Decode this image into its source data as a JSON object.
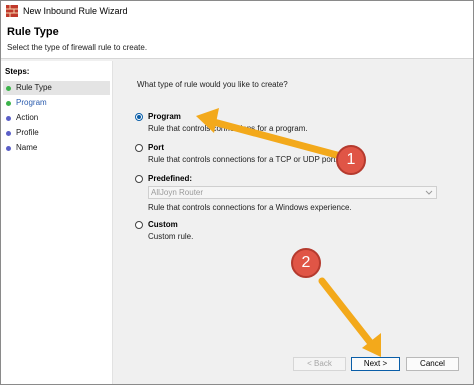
{
  "window": {
    "title": "New Inbound Rule Wizard"
  },
  "header": {
    "title": "Rule Type",
    "subtitle": "Select the type of firewall rule to create."
  },
  "steps": {
    "label": "Steps:",
    "items": [
      {
        "label": "Rule Type",
        "dot_color": "#3cb34a",
        "active": true
      },
      {
        "label": "Program",
        "dot_color": "#3cb34a",
        "active": false
      },
      {
        "label": "Action",
        "dot_color": "#5b5fc7",
        "active": false
      },
      {
        "label": "Profile",
        "dot_color": "#5b5fc7",
        "active": false
      },
      {
        "label": "Name",
        "dot_color": "#5b5fc7",
        "active": false
      }
    ]
  },
  "main": {
    "question": "What type of rule would you like to create?",
    "options": [
      {
        "title": "Program",
        "description": "Rule that controls connections for a program.",
        "checked": true
      },
      {
        "title": "Port",
        "description": "Rule that controls connections for a TCP or UDP port.",
        "checked": false
      },
      {
        "title": "Predefined:",
        "description": "Rule that controls connections for a Windows experience.",
        "checked": false
      },
      {
        "title": "Custom",
        "description": "Custom rule.",
        "checked": false
      }
    ],
    "predefined_select": {
      "value": "AllJoyn Router"
    }
  },
  "buttons": {
    "back": "< Back",
    "next": "Next >",
    "cancel": "Cancel"
  },
  "annotations": {
    "badge_1": "1",
    "badge_2": "2",
    "arrow_color": "#f3a91b",
    "badge_color": "#e05546"
  }
}
